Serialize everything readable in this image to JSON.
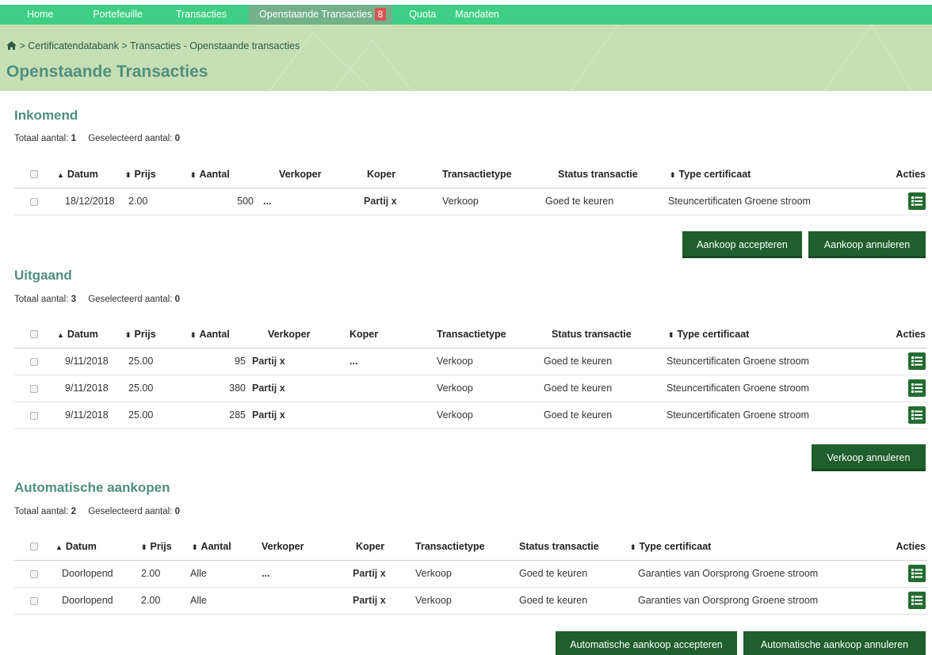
{
  "nav": {
    "items": [
      "Home",
      "Portefeuille",
      "Transacties",
      "Openstaande Transacties",
      "Quota",
      "Mandaten"
    ],
    "badge": "8"
  },
  "breadcrumb": {
    "separator": ">",
    "crumb1": "Certificatendatabank",
    "crumb2": "Transacties - Openstaande transacties"
  },
  "page_title": "Openstaande Transacties",
  "labels": {
    "total": "Totaal aantal:",
    "selected": "Geselecteerd aantal:"
  },
  "columns": {
    "datum": "Datum",
    "prijs": "Prijs",
    "aantal": "Aantal",
    "verkoper": "Verkoper",
    "koper": "Koper",
    "type": "Transactietype",
    "status": "Status transactie",
    "cert": "Type certificaat",
    "acties": "Acties"
  },
  "sort_up": "▲",
  "sort_both": "⬍",
  "inkomend": {
    "title": "Inkomend",
    "total": "1",
    "selected": "0",
    "rows": [
      {
        "datum": "18/12/2018",
        "prijs": "2.00",
        "aantal": "500",
        "verkoper": "...",
        "koper": "Partij x",
        "type": "Verkoop",
        "status": "Goed te keuren",
        "cert": "Steuncertificaten Groene stroom"
      }
    ],
    "buttons": [
      "Aankoop accepteren",
      "Aankoop annuleren"
    ]
  },
  "uitgaand": {
    "title": "Uitgaand",
    "total": "3",
    "selected": "0",
    "rows": [
      {
        "datum": "9/11/2018",
        "prijs": "25.00",
        "aantal": "95",
        "verkoper": "Partij x",
        "koper": "...",
        "type": "Verkoop",
        "status": "Goed te keuren",
        "cert": "Steuncertificaten Groene stroom"
      },
      {
        "datum": "9/11/2018",
        "prijs": "25.00",
        "aantal": "380",
        "verkoper": "Partij x",
        "koper": "",
        "type": "Verkoop",
        "status": "Goed te keuren",
        "cert": "Steuncertificaten Groene stroom"
      },
      {
        "datum": "9/11/2018",
        "prijs": "25.00",
        "aantal": "285",
        "verkoper": "Partij x",
        "koper": "",
        "type": "Verkoop",
        "status": "Goed te keuren",
        "cert": "Steuncertificaten Groene stroom"
      }
    ],
    "buttons": [
      "Verkoop annuleren"
    ]
  },
  "automatisch": {
    "title": "Automatische aankopen",
    "total": "2",
    "selected": "0",
    "rows": [
      {
        "datum": "Doorlopend",
        "prijs": "2.00",
        "aantal": "Alle",
        "verkoper": "...",
        "koper": "Partij x",
        "type": "Verkoop",
        "status": "Goed te keuren",
        "cert": "Garanties van Oorsprong Groene stroom"
      },
      {
        "datum": "Doorlopend",
        "prijs": "2.00",
        "aantal": "Alle",
        "verkoper": "",
        "koper": "Partij x",
        "type": "Verkoop",
        "status": "Goed te keuren",
        "cert": "Garanties van Oorsprong Groene stroom"
      }
    ],
    "buttons": [
      "Automatische aankoop accepteren",
      "Automatische aankoop annuleren"
    ]
  },
  "icons": {
    "home": "home-icon",
    "actions": "list-icon",
    "checkbox": "checkbox-icon"
  },
  "colors": {
    "nav": "#3fcf84",
    "nav_active": "#74b18b",
    "band": "#c7dfb4",
    "title": "#4f8f80",
    "button": "#1f5e2d",
    "badge": "#d9534f"
  }
}
